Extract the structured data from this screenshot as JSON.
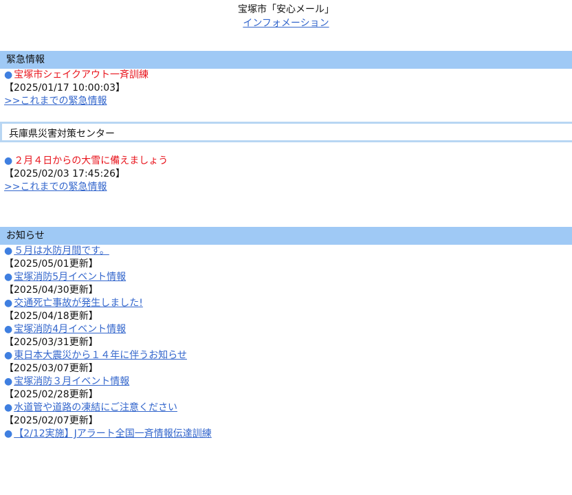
{
  "header": {
    "title": "宝塚市「安心メール」",
    "info_link": "インフォメーション"
  },
  "emergency": {
    "heading": "緊急情報",
    "item_title": "宝塚市シェイクアウト一斉訓練",
    "item_time": "【2025/01/17 10:00:03】",
    "more_link": ">>これまでの緊急情報"
  },
  "hyogo": {
    "heading": "兵庫県災害対策センター",
    "item_title": "２月４日からの大雪に備えましょう",
    "item_time": "【2025/02/03 17:45:26】",
    "more_link": ">>これまでの緊急情報"
  },
  "notices": {
    "heading": "お知らせ",
    "items": [
      {
        "title": "５月は水防月間です。",
        "date": "【2025/05/01更新】"
      },
      {
        "title": "宝塚消防5月イベント情報",
        "date": "【2025/04/30更新】"
      },
      {
        "title": "交通死亡事故が発生しました!",
        "date": "【2025/04/18更新】"
      },
      {
        "title": "宝塚消防4月イベント情報",
        "date": "【2025/03/31更新】"
      },
      {
        "title": "東日本大震災から１４年に伴うお知らせ",
        "date": "【2025/03/07更新】"
      },
      {
        "title": "宝塚消防３月イベント情報",
        "date": "【2025/02/28更新】"
      },
      {
        "title": "水道管や道路の凍結にご注意ください",
        "date": "【2025/02/07更新】"
      },
      {
        "title": "【2/12実施】Jアラート全国一斉情報伝達訓練",
        "date": ""
      }
    ]
  },
  "colors": {
    "section_bar": "#9fc9f5",
    "alert_red": "#e8141c",
    "link_blue": "#3366cc",
    "bullet_blue": "#3f7fe0"
  },
  "icons": {
    "bullet": "●"
  }
}
